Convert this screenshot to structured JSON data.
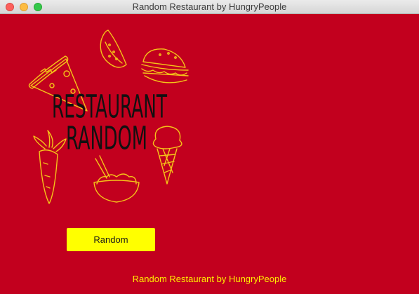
{
  "window": {
    "title": "Random Restaurant by HungryPeople"
  },
  "logo": {
    "line1": "RESTAURANT",
    "line2": "RANDOM"
  },
  "button": {
    "label": "Random"
  },
  "footer": {
    "text": "Random Restaurant by HungryPeople"
  },
  "colors": {
    "background": "#c2001e",
    "button": "#ffff00",
    "footer_text": "#ffee00",
    "doodle": "#f5c518"
  },
  "icons": [
    "pizza-icon",
    "watermelon-icon",
    "burger-icon",
    "carrot-icon",
    "ice-cream-icon",
    "noodle-bowl-icon"
  ]
}
